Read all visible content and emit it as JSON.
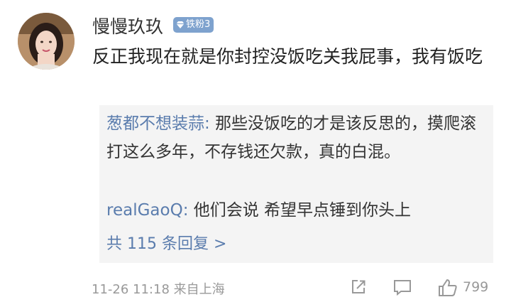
{
  "user": {
    "name": "慢慢玖玖",
    "badge": "铁粉3"
  },
  "post": {
    "text": "反正我现在就是你封控没饭吃关我屁事，我有饭吃"
  },
  "replies": [
    {
      "author": "葱都不想装蒜",
      "sep": ":",
      "text": " 那些没饭吃的才是该反思的，摸爬滚打这么多年，不存钱还欠款，真的白混。"
    },
    {
      "author": "realGaoQ",
      "sep": ":",
      "text": " 他们会说  希望早点锤到你头上"
    }
  ],
  "more_replies": "共 115 条回复 >",
  "meta": {
    "datetime": "11-26 11:18",
    "location": "来自上海"
  },
  "actions": {
    "like_count": "799"
  },
  "icons": [
    "avatar",
    "gem-icon",
    "share-icon",
    "comment-icon",
    "like-icon"
  ]
}
